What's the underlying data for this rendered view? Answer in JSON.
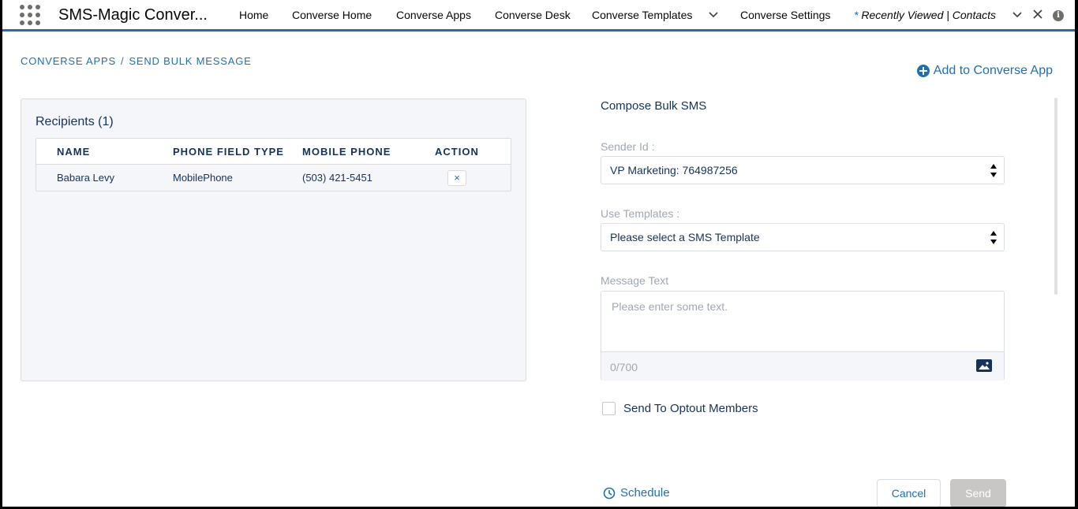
{
  "nav": {
    "app_name": "SMS-Magic Conver...",
    "items": [
      "Home",
      "Converse Home",
      "Converse Apps",
      "Converse Desk",
      "Converse Templates",
      "Converse Settings"
    ],
    "recent_star": "*",
    "recent_label": "Recently Viewed | Contacts"
  },
  "breadcrumb": {
    "parent": "CONVERSE APPS",
    "separator": "/",
    "current": "SEND BULK MESSAGE"
  },
  "add_app_label": "Add to Converse App",
  "recipients": {
    "title": "Recipients (1)",
    "columns": [
      "NAME",
      "PHONE FIELD TYPE",
      "MOBILE PHONE",
      "ACTION"
    ],
    "rows": [
      {
        "name": "Babara Levy",
        "field_type": "MobilePhone",
        "phone": "(503) 421-5451",
        "action": "×"
      }
    ]
  },
  "compose": {
    "title": "Compose Bulk SMS",
    "sender_label": "Sender Id :",
    "sender_value": "VP Marketing: 764987256",
    "templates_label": "Use Templates :",
    "templates_value": "Please select a SMS Template",
    "message_label": "Message Text",
    "message_placeholder": "Please enter some text.",
    "char_count": "0/700",
    "optout_label": "Send To Optout Members",
    "schedule_label": "Schedule",
    "cancel_label": "Cancel",
    "send_label": "Send"
  },
  "colors": {
    "brand_blue": "#1f6fb3",
    "text_dark": "#16325c",
    "disabled_gray": "#c9c7c5"
  }
}
